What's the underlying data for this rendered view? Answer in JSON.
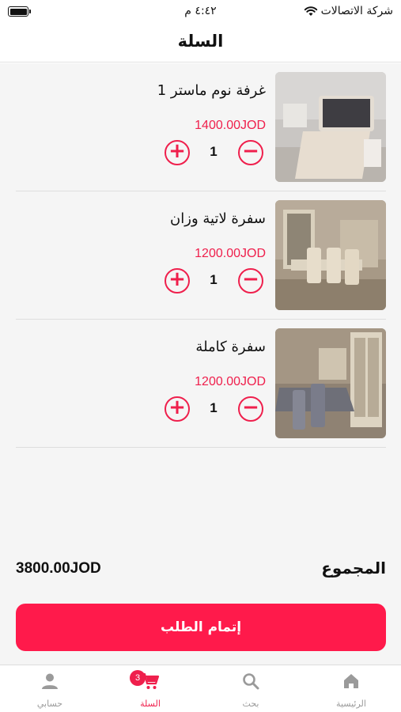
{
  "status_bar": {
    "carrier": "شركة الاتصالات",
    "time": "٤:٤٢ م",
    "wifi_icon": "wifi-icon",
    "battery_icon": "battery-icon"
  },
  "header": {
    "title": "السلة"
  },
  "cart": {
    "items": [
      {
        "name": "غرفة نوم ماستر 1",
        "price": "1400.00JOD",
        "quantity": "1",
        "image": "bedroom-photo"
      },
      {
        "name": "سفرة لاتية وزان",
        "price": "1200.00JOD",
        "quantity": "1",
        "image": "dining-room-photo"
      },
      {
        "name": "سفرة كاملة",
        "price": "1200.00JOD",
        "quantity": "1",
        "image": "dining-set-photo"
      }
    ],
    "plus_symbol": "+",
    "minus_symbol": "−"
  },
  "total": {
    "label": "المجموع",
    "value": "3800.00JOD"
  },
  "checkout": {
    "label": "إتمام الطلب"
  },
  "tab_bar": {
    "tabs": [
      {
        "label": "الرئيسية",
        "icon": "home-icon"
      },
      {
        "label": "بحث",
        "icon": "search-icon"
      },
      {
        "label": "السلة",
        "icon": "cart-icon",
        "badge": "3",
        "active": true
      },
      {
        "label": "حسابي",
        "icon": "user-icon"
      }
    ]
  },
  "colors": {
    "accent": "#ef1f4c",
    "button": "#ff1a4b",
    "inactive_tab": "#9a9a9a",
    "background": "#f5f5f5"
  }
}
